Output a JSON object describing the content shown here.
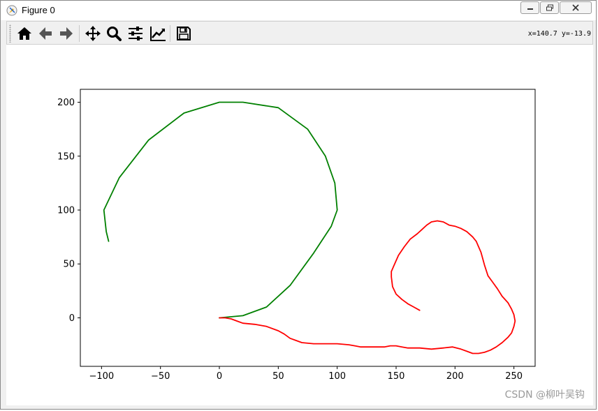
{
  "window": {
    "title": "Figure 0"
  },
  "toolbar": {
    "buttons": [
      {
        "name": "home-button",
        "icon": "home-icon"
      },
      {
        "name": "back-button",
        "icon": "arrow-left-icon"
      },
      {
        "name": "forward-button",
        "icon": "arrow-right-icon"
      },
      {
        "name": "pan-button",
        "icon": "move-icon"
      },
      {
        "name": "zoom-button",
        "icon": "magnifier-icon"
      },
      {
        "name": "configure-subplots-button",
        "icon": "sliders-icon"
      },
      {
        "name": "edit-axis-button",
        "icon": "line-chart-icon"
      },
      {
        "name": "save-button",
        "icon": "floppy-disk-icon"
      }
    ],
    "coords_readout": "x=140.7 y=-13.9"
  },
  "watermark": "CSDN @柳叶吴钩",
  "chart_data": {
    "type": "line",
    "title": "",
    "xlabel": "",
    "ylabel": "",
    "xlim": [
      -118,
      268
    ],
    "ylim": [
      -45,
      212
    ],
    "xticks": [
      -100,
      -50,
      0,
      50,
      100,
      150,
      200,
      250
    ],
    "yticks": [
      0,
      50,
      100,
      150,
      200
    ],
    "grid": false,
    "series": [
      {
        "color": "#008000",
        "x": [
          0,
          20,
          40,
          60,
          80,
          95,
          100,
          98,
          90,
          75,
          50,
          20,
          0,
          -30,
          -60,
          -85,
          -98,
          -96,
          -94
        ],
        "y": [
          0,
          2,
          10,
          30,
          60,
          85,
          100,
          125,
          150,
          175,
          195,
          200,
          200,
          190,
          165,
          130,
          100,
          80,
          71
        ]
      },
      {
        "color": "#ff0000",
        "x": [
          0,
          5,
          10,
          15,
          20,
          30,
          40,
          50,
          55,
          60,
          65,
          70,
          80,
          90,
          100,
          110,
          115,
          120,
          130,
          140,
          145,
          150,
          155,
          160,
          165,
          170,
          180,
          190,
          198,
          205,
          210,
          215,
          220,
          225,
          230,
          235,
          240,
          245,
          248,
          250,
          251,
          250,
          248,
          245,
          240,
          236,
          232,
          228,
          225,
          223,
          222,
          220,
          218,
          215,
          210,
          205,
          200,
          195,
          190,
          185,
          180,
          176,
          172,
          168,
          162,
          157,
          152,
          148,
          146,
          146,
          147,
          150,
          155,
          160,
          165,
          170
        ],
        "y": [
          0,
          0,
          -1,
          -3,
          -5,
          -6,
          -8,
          -12,
          -15,
          -19,
          -21,
          -23,
          -24,
          -24,
          -24,
          -25,
          -26,
          -27,
          -27,
          -27,
          -26,
          -26,
          -27,
          -28,
          -28,
          -28,
          -29,
          -28,
          -27,
          -29,
          -31,
          -33,
          -33,
          -32,
          -30,
          -27,
          -23,
          -18,
          -14,
          -8,
          -3,
          3,
          8,
          14,
          20,
          27,
          33,
          39,
          49,
          57,
          61,
          66,
          71,
          75,
          80,
          83,
          85,
          86,
          89,
          90,
          89,
          86,
          82,
          78,
          73,
          66,
          58,
          48,
          43,
          38,
          29,
          22,
          17,
          13,
          10,
          7
        ]
      }
    ]
  }
}
